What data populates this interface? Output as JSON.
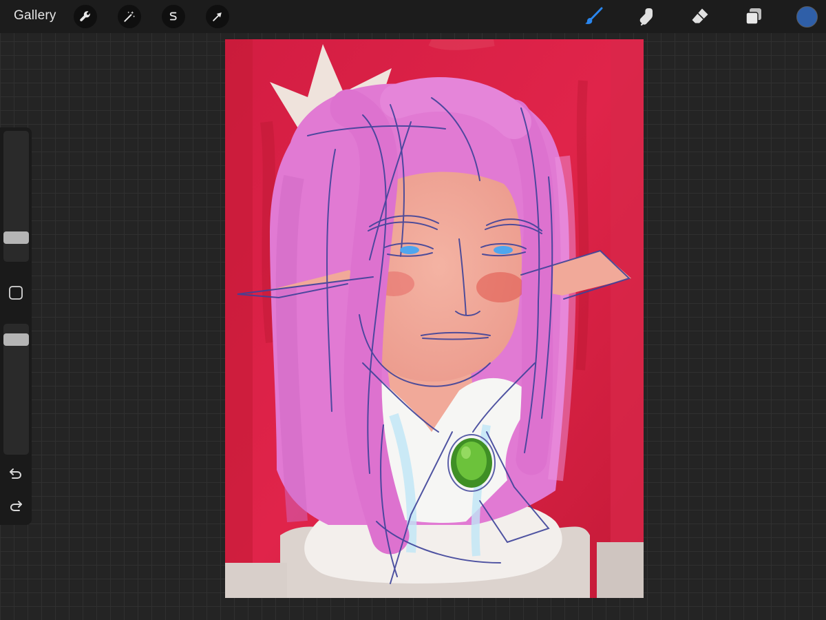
{
  "topbar": {
    "gallery_label": "Gallery",
    "left_tools": [
      {
        "name": "actions",
        "icon": "wrench-icon"
      },
      {
        "name": "adjustments",
        "icon": "magic-wand-icon"
      },
      {
        "name": "selection",
        "icon": "selection-s-icon"
      },
      {
        "name": "transform",
        "icon": "arrow-cursor-icon"
      }
    ],
    "right_tools": [
      {
        "name": "brush",
        "icon": "brush-icon",
        "active": true
      },
      {
        "name": "smudge",
        "icon": "smudge-finger-icon",
        "active": false
      },
      {
        "name": "eraser",
        "icon": "eraser-icon",
        "active": false
      },
      {
        "name": "layers",
        "icon": "layers-icon",
        "active": false
      }
    ],
    "current_color": "#2f5fa8"
  },
  "sidebar": {
    "brush_size_level": 0.15,
    "opacity_level": 0.92,
    "icons": [
      "modify-square-icon",
      "undo-icon",
      "redo-icon"
    ]
  },
  "colors": {
    "accent": "#1f7de0",
    "canvas_red": "#d4203f",
    "hair_pink": "#e07ad2",
    "sketch_blue": "#3a3f9a",
    "gem_green": "#4aa12b"
  }
}
